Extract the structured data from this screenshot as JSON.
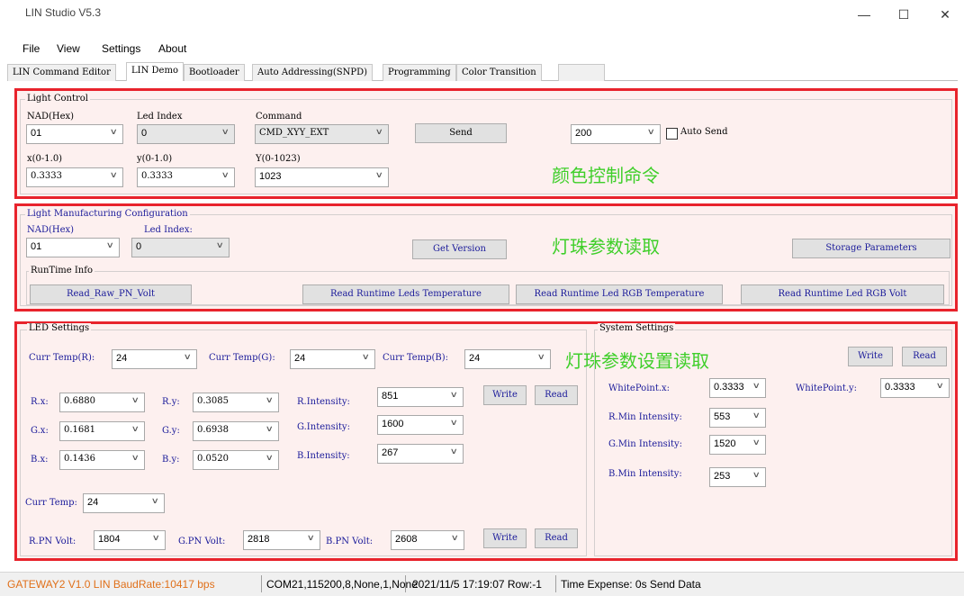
{
  "window": {
    "title": "LIN Studio V5.3",
    "minimize": "—",
    "maximize": "☐",
    "close": "✕"
  },
  "menu": [
    "File",
    "View",
    "Settings",
    "About"
  ],
  "tabs": [
    "LIN Command Editor",
    "LIN Demo",
    "Bootloader",
    "Auto Addressing(SNPD)",
    "Programming",
    "Color Transition"
  ],
  "light_control": {
    "title": "Light Control",
    "nad_label": "NAD(Hex)",
    "nad_value": "01",
    "led_index_label": "Led Index",
    "led_index_value": "0",
    "command_label": "Command",
    "command_value": "CMD_XYY_EXT",
    "send": "Send",
    "interval_value": "200",
    "auto_send": "Auto Send",
    "x_label": "x(0-1.0)",
    "x_value": "0.3333",
    "y_label": "y(0-1.0)",
    "y_value": "0.3333",
    "Y_label": "Y(0-1023)",
    "Y_value": "1023",
    "annotation": "颜色控制命令"
  },
  "manufacturing": {
    "title": "Light Manufacturing Configuration",
    "nad_label": "NAD(Hex)",
    "nad_value": "01",
    "led_index_label": "Led Index:",
    "led_index_value": "0",
    "get_version": "Get Version",
    "annotation": "灯珠参数读取",
    "storage": "Storage Parameters",
    "runtime_title": "RunTime Info",
    "read_raw": "Read_Raw_PN_Volt",
    "read_temp": "Read Runtime Leds Temperature",
    "read_rgb_temp": "Read Runtime Led RGB Temperature",
    "read_rgb_volt": "Read Runtime Led RGB Volt"
  },
  "led_settings": {
    "title": "LED Settings",
    "curr_temp_r_label": "Curr Temp(R):",
    "curr_temp_r": "24",
    "curr_temp_g_label": "Curr Temp(G):",
    "curr_temp_g": "24",
    "curr_temp_b_label": "Curr Temp(B):",
    "curr_temp_b": "24",
    "annotation": "灯珠参数设置读取",
    "rx_label": "R.x:",
    "rx": "0.6880",
    "ry_label": "R.y:",
    "ry": "0.3085",
    "ri_label": "R.Intensity:",
    "ri": "851",
    "gx_label": "G.x:",
    "gx": "0.1681",
    "gy_label": "G.y:",
    "gy": "0.6938",
    "gi_label": "G.Intensity:",
    "gi": "1600",
    "bx_label": "B.x:",
    "bx": "0.1436",
    "by_label": "B.y:",
    "by": "0.0520",
    "bi_label": "B.Intensity:",
    "bi": "267",
    "write": "Write",
    "read": "Read",
    "curr_temp_label": "Curr Temp:",
    "curr_temp": "24",
    "r_pn_label": "R.PN Volt:",
    "r_pn": "1804",
    "g_pn_label": "G.PN Volt:",
    "g_pn": "2818",
    "b_pn_label": "B.PN Volt:",
    "b_pn": "2608"
  },
  "system_settings": {
    "title": "System Settings",
    "write": "Write",
    "read": "Read",
    "wpx_label": "WhitePoint.x:",
    "wpx": "0.3333",
    "wpy_label": "WhitePoint.y:",
    "wpy": "0.3333",
    "rmin_label": "R.Min Intensity:",
    "rmin": "553",
    "gmin_label": "G.Min Intensity:",
    "gmin": "1520",
    "bmin_label": "B.Min Intensity:",
    "bmin": "253"
  },
  "status": {
    "gateway": "GATEWAY2  V1.0   LIN BaudRate:10417 bps",
    "port": "COM21,115200,8,None,1,None",
    "time": "2021/11/5 17:19:07  Row:-1",
    "expense": "Time Expense: 0s  Send Data"
  },
  "colors": {
    "section_border": "#e8232c",
    "section_fill": "#fdf0ef",
    "annotation": "#3fcf2a",
    "status_accent": "#e0701a"
  }
}
